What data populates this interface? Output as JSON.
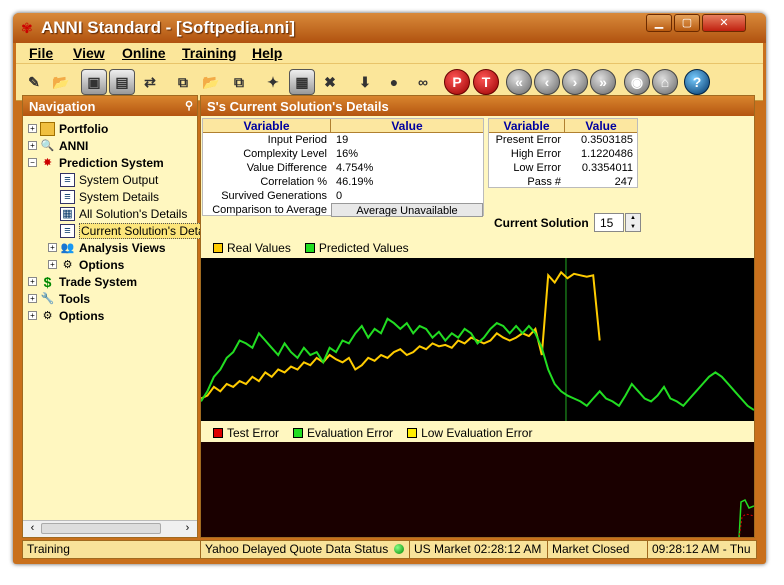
{
  "window": {
    "title": "ANNI Standard - [Softpedia.nni]"
  },
  "menu": [
    "File",
    "View",
    "Online",
    "Training",
    "Help"
  ],
  "toolbar": [
    {
      "name": "new-icon",
      "glyph": "✎",
      "style": "pl"
    },
    {
      "name": "open-folder-icon",
      "glyph": "📂",
      "style": "pl"
    },
    {
      "name": "save-icon",
      "glyph": "▣",
      "style": "sq"
    },
    {
      "name": "save-as-icon",
      "glyph": "▤",
      "style": "sq"
    },
    {
      "name": "exchange-icon",
      "glyph": "⇄",
      "style": "pl"
    },
    {
      "name": "copy-icon",
      "glyph": "⧉",
      "style": "pl"
    },
    {
      "name": "open-icon",
      "glyph": "📂",
      "style": "pl"
    },
    {
      "name": "duplicate-icon",
      "glyph": "⧉",
      "style": "pl"
    },
    {
      "name": "scatter-icon",
      "glyph": "✦",
      "style": "pl"
    },
    {
      "name": "grid-icon",
      "glyph": "▦",
      "style": "sq"
    },
    {
      "name": "delete-icon",
      "glyph": "✖",
      "style": "pl"
    },
    {
      "name": "download-icon",
      "glyph": "⬇",
      "style": "pl"
    },
    {
      "name": "coins-icon",
      "glyph": "●",
      "style": "pl"
    },
    {
      "name": "binoculars-icon",
      "glyph": "∞",
      "style": "pl"
    },
    {
      "name": "p-button-icon",
      "glyph": "P",
      "style": "rd"
    },
    {
      "name": "t-button-icon",
      "glyph": "T",
      "style": "rd"
    },
    {
      "name": "first-icon",
      "glyph": "«",
      "style": "gr"
    },
    {
      "name": "previous-icon",
      "glyph": "‹",
      "style": "gr"
    },
    {
      "name": "next-icon",
      "glyph": "›",
      "style": "gr"
    },
    {
      "name": "last-icon",
      "glyph": "»",
      "style": "gr"
    },
    {
      "name": "globe-icon",
      "glyph": "◉",
      "style": "gr"
    },
    {
      "name": "home-icon",
      "glyph": "⌂",
      "style": "gr"
    },
    {
      "name": "help-icon",
      "glyph": "?",
      "style": "bl"
    }
  ],
  "navigation": {
    "title": "Navigation",
    "items": [
      {
        "label": "Portfolio",
        "level": 0,
        "expander": "+",
        "icon": "folder-icon"
      },
      {
        "label": "ANNI",
        "level": 0,
        "expander": "+",
        "icon": "magnifier-icon"
      },
      {
        "label": "Prediction System",
        "level": 0,
        "expander": "−",
        "icon": "network-icon"
      },
      {
        "label": "System Output",
        "level": 1,
        "expander": "",
        "icon": "document-icon"
      },
      {
        "label": "System Details",
        "level": 1,
        "expander": "",
        "icon": "document-icon"
      },
      {
        "label": "All Solution's Details",
        "level": 1,
        "expander": "",
        "icon": "table-icon"
      },
      {
        "label": "Current Solution's Details",
        "level": 1,
        "expander": "",
        "icon": "document-icon",
        "selected": true
      },
      {
        "label": "Analysis Views",
        "level": 1,
        "expander": "+",
        "icon": "people-icon",
        "bold": true
      },
      {
        "label": "Options",
        "level": 1,
        "expander": "+",
        "icon": "tools-icon",
        "bold": true
      },
      {
        "label": "Trade System",
        "level": 0,
        "expander": "+",
        "icon": "dollar-icon"
      },
      {
        "label": "Tools",
        "level": 0,
        "expander": "+",
        "icon": "wrench-icon"
      },
      {
        "label": "Options",
        "level": 0,
        "expander": "+",
        "icon": "tools-icon"
      }
    ]
  },
  "main": {
    "title": "S's Current Solution's Details",
    "details_table": {
      "headers": [
        "Variable",
        "Value"
      ],
      "rows": [
        [
          "Input Period",
          "19"
        ],
        [
          "Complexity Level",
          "16%"
        ],
        [
          "Value Difference",
          "4.754%"
        ],
        [
          "Correlation %",
          "46.19%"
        ],
        [
          "Survived Generations",
          "0"
        ],
        [
          "Comparison to Average",
          "Average Unavailable"
        ]
      ]
    },
    "error_table": {
      "headers": [
        "Variable",
        "Value"
      ],
      "rows": [
        [
          "Present Error",
          "0.3503185"
        ],
        [
          "High Error",
          "1.1220486"
        ],
        [
          "Low Error",
          "0.3354011"
        ],
        [
          "Pass #",
          "247"
        ]
      ]
    },
    "current_solution_label": "Current Solution",
    "current_solution_value": "15"
  },
  "chart_data": [
    {
      "type": "line",
      "title": "",
      "series": [
        {
          "name": "Real Values",
          "color": "#ffcc00",
          "values": [
            0.1,
            0.12,
            0.18,
            0.15,
            0.2,
            0.18,
            0.22,
            0.2,
            0.25,
            0.22,
            0.28,
            0.25,
            0.3,
            0.28,
            0.32,
            0.3,
            0.35,
            0.33,
            0.38,
            0.35,
            0.4,
            0.37,
            0.35,
            0.38,
            0.3,
            0.33,
            0.38,
            0.36,
            0.4,
            0.38,
            0.42,
            0.44,
            0.4,
            0.42,
            0.46,
            0.44,
            0.48,
            0.46,
            0.47,
            0.45,
            0.5,
            0.48,
            0.52,
            0.5,
            0.48,
            0.5,
            0.55,
            0.52,
            0.5,
            0.52,
            0.55,
            0.53,
            0.58,
            0.4,
            0.95,
            0.9,
            0.97,
            0.93,
            0.96,
            0.95,
            0.94,
            0.95,
            0.5
          ]
        },
        {
          "name": "Predicted Values",
          "color": "#22dd22",
          "values": [
            0.08,
            0.15,
            0.25,
            0.3,
            0.38,
            0.42,
            0.5,
            0.48,
            0.45,
            0.55,
            0.5,
            0.45,
            0.4,
            0.48,
            0.42,
            0.38,
            0.45,
            0.4,
            0.42,
            0.35,
            0.45,
            0.42,
            0.5,
            0.48,
            0.55,
            0.6,
            0.52,
            0.58,
            0.55,
            0.65,
            0.62,
            0.58,
            0.62,
            0.55,
            0.6,
            0.58,
            0.52,
            0.56,
            0.5,
            0.55,
            0.52,
            0.58,
            0.55,
            0.48,
            0.52,
            0.58,
            0.62,
            0.6,
            0.55,
            0.6,
            0.55,
            0.6,
            0.55,
            0.45,
            0.3,
            0.2,
            0.15,
            0.12,
            0.1,
            0.08,
            0.05,
            0.1,
            0.15,
            0.1,
            0.08,
            0.05,
            0.12,
            0.2,
            0.15,
            0.1,
            0.08,
            0.12,
            0.18,
            0.1,
            0.08,
            0.05,
            0.1,
            0.15,
            0.2,
            0.25,
            0.28,
            0.25,
            0.2,
            0.15,
            0.1,
            0.05,
            0.02
          ]
        }
      ],
      "divider_fraction": 0.66
    },
    {
      "type": "line",
      "title": "",
      "series": [
        {
          "name": "Test Error",
          "color": "#dd0000",
          "values": []
        },
        {
          "name": "Evaluation Error",
          "color": "#22dd22",
          "values": []
        },
        {
          "name": "Low Evaluation Error",
          "color": "#ffee00",
          "values": []
        }
      ]
    }
  ],
  "status": {
    "state": "Training",
    "quote_status": "Yahoo Delayed Quote Data Status",
    "us_market": "US Market 02:28:12 AM",
    "market_state": "Market Closed",
    "local_time": "09:28:12 AM - Thu"
  }
}
